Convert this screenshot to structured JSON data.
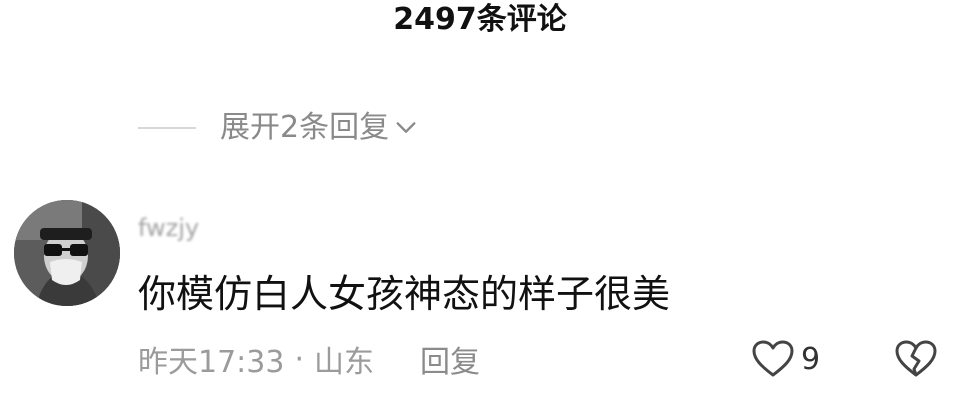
{
  "header": {
    "title": "2497条评论"
  },
  "thread": {
    "expand_label": "展开2条回复"
  },
  "comment": {
    "username": "fwzjy",
    "text": "你模仿白人女孩神态的样子很美",
    "time": "昨天17:33",
    "separator": "·",
    "location": "山东",
    "reply_label": "回复",
    "like_count": "9"
  },
  "colors": {
    "text_primary": "#111111",
    "text_secondary": "#9b9b9b",
    "divider": "#d8d8d8",
    "background": "#ffffff"
  },
  "icons": {
    "expand": "chevron-down-icon",
    "like": "heart-outline-icon",
    "dislike": "broken-heart-icon"
  }
}
